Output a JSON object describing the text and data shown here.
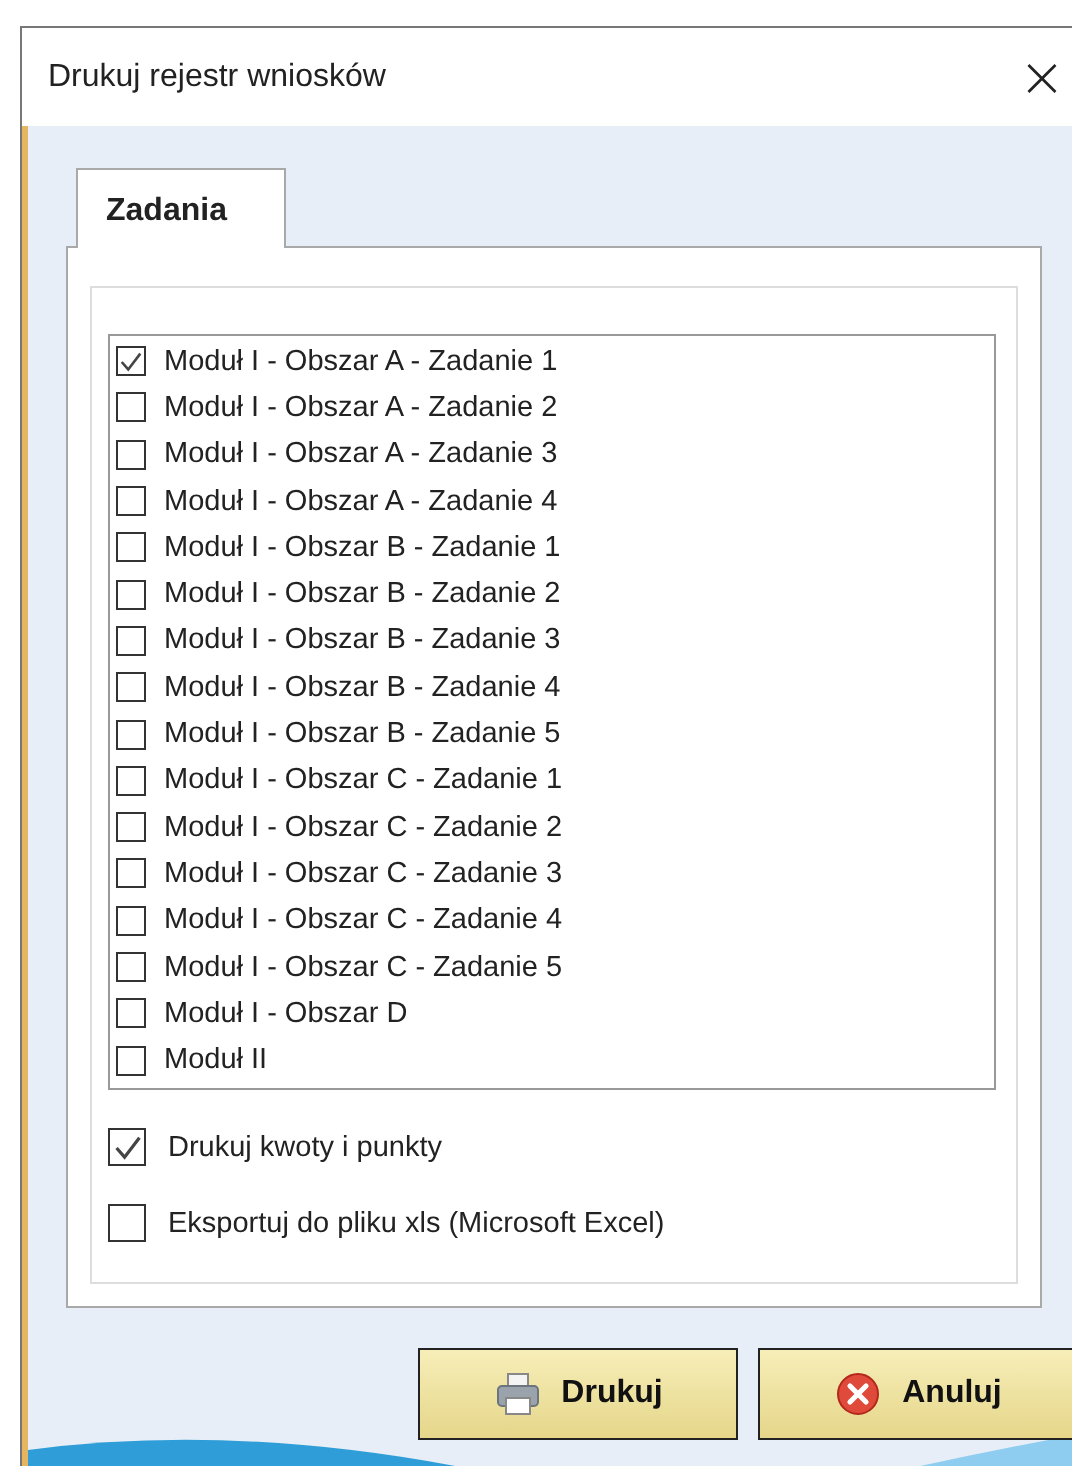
{
  "window": {
    "title": "Drukuj rejestr wniosków",
    "close": "×"
  },
  "tabs": [
    {
      "label": "Zadania",
      "selected": true
    }
  ],
  "tasks": [
    {
      "label": "Moduł I - Obszar A - Zadanie 1",
      "checked": true
    },
    {
      "label": "Moduł I - Obszar A - Zadanie 2",
      "checked": false
    },
    {
      "label": "Moduł I - Obszar A - Zadanie 3",
      "checked": false
    },
    {
      "label": "Moduł I - Obszar A - Zadanie 4",
      "checked": false
    },
    {
      "label": "Moduł I - Obszar B - Zadanie 1",
      "checked": false
    },
    {
      "label": "Moduł I - Obszar B - Zadanie 2",
      "checked": false
    },
    {
      "label": "Moduł I - Obszar B - Zadanie 3",
      "checked": false
    },
    {
      "label": "Moduł I - Obszar B - Zadanie 4",
      "checked": false
    },
    {
      "label": "Moduł I - Obszar B - Zadanie 5",
      "checked": false
    },
    {
      "label": "Moduł I - Obszar C - Zadanie 1",
      "checked": false
    },
    {
      "label": "Moduł I - Obszar C - Zadanie 2",
      "checked": false
    },
    {
      "label": "Moduł I - Obszar C - Zadanie 3",
      "checked": false
    },
    {
      "label": "Moduł I - Obszar C - Zadanie 4",
      "checked": false
    },
    {
      "label": "Moduł I - Obszar C - Zadanie 5",
      "checked": false
    },
    {
      "label": "Moduł I - Obszar D",
      "checked": false
    },
    {
      "label": "Moduł II",
      "checked": false
    }
  ],
  "options": [
    {
      "label": "Drukuj kwoty i punkty",
      "checked": true
    },
    {
      "label": "Eksportuj do pliku xls (Microsoft Excel)",
      "checked": false
    }
  ],
  "buttons": [
    {
      "label": "Drukuj",
      "kind": "print"
    },
    {
      "label": "Anuluj",
      "kind": "cancel"
    }
  ]
}
